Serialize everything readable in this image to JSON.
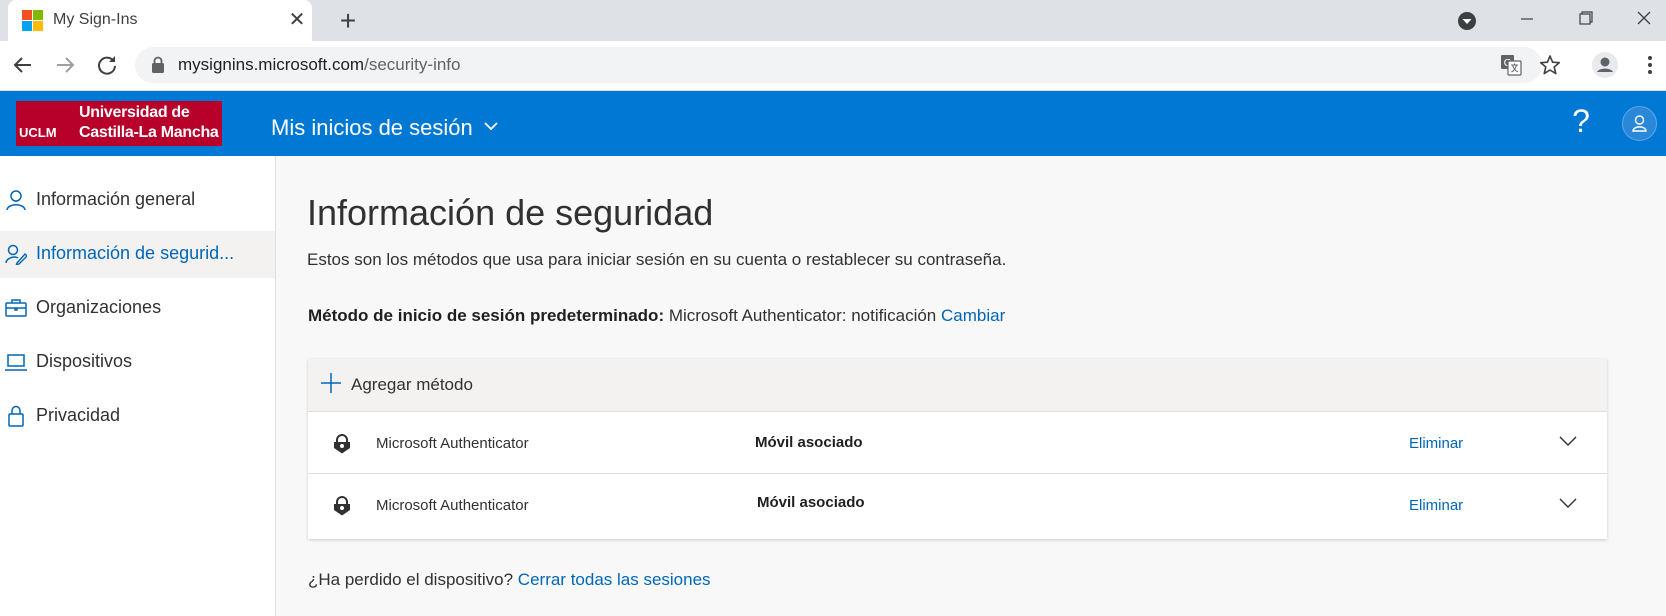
{
  "browser": {
    "tab_title": "My Sign-Ins",
    "url_host": "mysignins.microsoft.com",
    "url_path": "/security-info",
    "favicon_colors": [
      "#f25022",
      "#7fba00",
      "#00a4ef",
      "#ffb900"
    ]
  },
  "header": {
    "logo_line1": "Universidad de",
    "logo_line2": "Castilla-La Mancha",
    "logo_short": "UCLM",
    "app_title": "Mis inicios de sesión",
    "help_label": "?",
    "accent_color": "#0078d4"
  },
  "sidebar": {
    "items": [
      {
        "label": "Información general",
        "icon": "person-icon",
        "active": false
      },
      {
        "label": "Información de segurid...",
        "icon": "security-info-icon",
        "active": true
      },
      {
        "label": "Organizaciones",
        "icon": "briefcase-icon",
        "active": false
      },
      {
        "label": "Dispositivos",
        "icon": "laptop-icon",
        "active": false
      },
      {
        "label": "Privacidad",
        "icon": "lock-icon",
        "active": false
      }
    ]
  },
  "main": {
    "title": "Información de seguridad",
    "subtitle": "Estos son los métodos que usa para iniciar sesión en su cuenta o restablecer su contraseña.",
    "default_method_label": "Método de inicio de sesión predeterminado:",
    "default_method_value": "Microsoft Authenticator: notificación",
    "change_link": "Cambiar",
    "add_method": "Agregar método",
    "methods": [
      {
        "name": "Microsoft Authenticator",
        "detail": "Móvil asociado",
        "delete": "Eliminar",
        "icon": "authenticator-lock-icon"
      },
      {
        "name": "Microsoft Authenticator",
        "detail": "Móvil asociado",
        "delete": "Eliminar",
        "icon": "authenticator-lock-icon"
      }
    ],
    "lost_device_text": "¿Ha perdido el dispositivo?",
    "sign_out_all_link": "Cerrar todas las sesiones"
  }
}
